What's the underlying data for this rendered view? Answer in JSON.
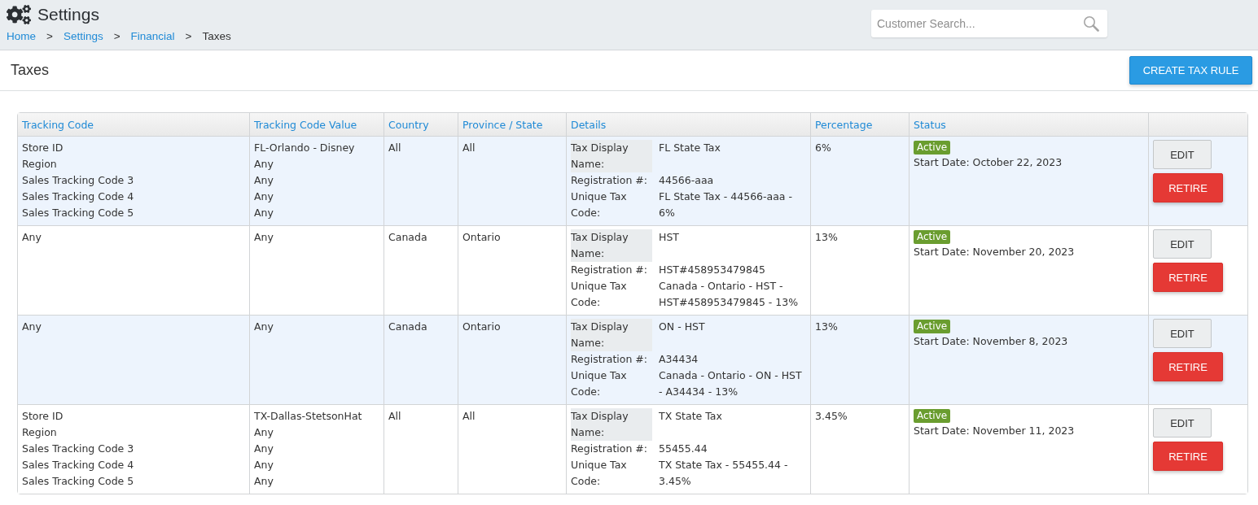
{
  "header": {
    "title": "Settings",
    "breadcrumb": [
      {
        "label": "Home",
        "separator": ">",
        "current": false
      },
      {
        "label": "Settings",
        "separator": ">",
        "current": false
      },
      {
        "label": "Financial",
        "separator": ">",
        "current": false
      },
      {
        "label": "Taxes",
        "current": true
      }
    ],
    "search": {
      "placeholder": "Customer Search..."
    }
  },
  "page": {
    "title": "Taxes",
    "create_button": "CREATE TAX RULE"
  },
  "table": {
    "columns": [
      "Tracking Code",
      "Tracking Code Value",
      "Country",
      "Province / State",
      "Details",
      "Percentage",
      "Status"
    ],
    "rows": [
      {
        "tracking_codes": [
          {
            "code": "Store ID",
            "value": "FL-Orlando - Disney"
          },
          {
            "code": "Region",
            "value": "Any"
          },
          {
            "code": "Sales Tracking Code 3",
            "value": "Any"
          },
          {
            "code": "Sales Tracking Code 4",
            "value": "Any"
          },
          {
            "code": "Sales Tracking Code 5",
            "value": "Any"
          }
        ],
        "country": "All",
        "province": "All",
        "details": [
          {
            "label": "Tax Display Name:",
            "value": "FL State Tax"
          },
          {
            "label": "Registration #:",
            "value": "44566-aaa"
          },
          {
            "label": "Unique Tax Code:",
            "value": "FL State Tax - 44566-aaa - 6%"
          }
        ],
        "percentage": "6%",
        "status": "Active",
        "start_date": "Start Date: October 22, 2023",
        "actions": [
          {
            "label": "EDIT",
            "kind": "edit"
          },
          {
            "label": "RETIRE",
            "kind": "retire"
          }
        ]
      },
      {
        "tracking_codes": [
          {
            "code": "Any",
            "value": "Any"
          }
        ],
        "country": "Canada",
        "province": "Ontario",
        "details": [
          {
            "label": "Tax Display Name:",
            "value": "HST"
          },
          {
            "label": "Registration #:",
            "value": "HST#458953479845"
          },
          {
            "label": "Unique Tax Code:",
            "value": "Canada - Ontario - HST - HST#458953479845 - 13%"
          }
        ],
        "percentage": "13%",
        "status": "Active",
        "start_date": "Start Date: November 20, 2023",
        "actions": [
          {
            "label": "EDIT",
            "kind": "edit"
          },
          {
            "label": "RETIRE",
            "kind": "retire"
          }
        ]
      },
      {
        "tracking_codes": [
          {
            "code": "Any",
            "value": "Any"
          }
        ],
        "country": "Canada",
        "province": "Ontario",
        "details": [
          {
            "label": "Tax Display Name:",
            "value": "ON - HST"
          },
          {
            "label": "Registration #:",
            "value": "A34434"
          },
          {
            "label": "Unique Tax Code:",
            "value": "Canada - Ontario - ON - HST - A34434 - 13%"
          }
        ],
        "percentage": "13%",
        "status": "Active",
        "start_date": "Start Date: November 8, 2023",
        "actions": [
          {
            "label": "EDIT",
            "kind": "edit"
          },
          {
            "label": "RETIRE",
            "kind": "retire"
          }
        ]
      },
      {
        "tracking_codes": [
          {
            "code": "Store ID",
            "value": "TX-Dallas-StetsonHat"
          },
          {
            "code": "Region",
            "value": "Any"
          },
          {
            "code": "Sales Tracking Code 3",
            "value": "Any"
          },
          {
            "code": "Sales Tracking Code 4",
            "value": "Any"
          },
          {
            "code": "Sales Tracking Code 5",
            "value": "Any"
          }
        ],
        "country": "All",
        "province": "All",
        "details": [
          {
            "label": "Tax Display Name:",
            "value": "TX State Tax"
          },
          {
            "label": "Registration #:",
            "value": "55455.44"
          },
          {
            "label": "Unique Tax Code:",
            "value": "TX State Tax - 55455.44 - 3.45%"
          }
        ],
        "percentage": "3.45%",
        "status": "Active",
        "start_date": "Start Date: November 11, 2023",
        "actions": [
          {
            "label": "EDIT",
            "kind": "edit"
          },
          {
            "label": "RETIRE",
            "kind": "retire"
          }
        ]
      }
    ]
  }
}
